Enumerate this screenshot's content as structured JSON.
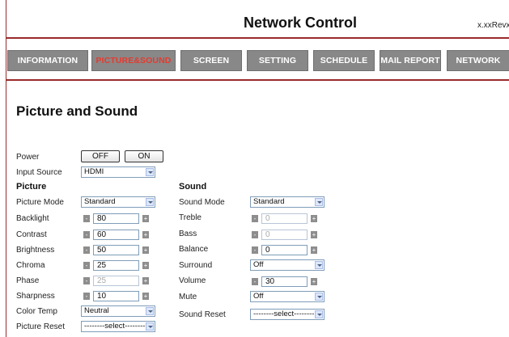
{
  "header": {
    "title": "Network Control",
    "revision": "x.xxRevx"
  },
  "nav": [
    {
      "label": "INFORMATION",
      "active": false
    },
    {
      "label": "PICTURE&SOUND",
      "active": true
    },
    {
      "label": "SCREEN",
      "active": false
    },
    {
      "label": "SETTING",
      "active": false
    },
    {
      "label": "SCHEDULE",
      "active": false
    },
    {
      "label": "MAIL REPORT",
      "active": false
    },
    {
      "label": "NETWORK",
      "active": false
    }
  ],
  "page_title": "Picture and Sound",
  "power": {
    "label": "Power",
    "off": "OFF",
    "on": "ON"
  },
  "input_source": {
    "label": "Input Source",
    "value": "HDMI"
  },
  "picture": {
    "heading": "Picture",
    "picture_mode": {
      "label": "Picture Mode",
      "value": "Standard"
    },
    "backlight": {
      "label": "Backlight",
      "value": "80"
    },
    "contrast": {
      "label": "Contrast",
      "value": "60"
    },
    "brightness": {
      "label": "Brightness",
      "value": "50"
    },
    "chroma": {
      "label": "Chroma",
      "value": "25"
    },
    "phase": {
      "label": "Phase",
      "value": "25"
    },
    "sharpness": {
      "label": "Sharpness",
      "value": "10"
    },
    "color_temp": {
      "label": "Color Temp",
      "value": "Neutral"
    },
    "picture_reset": {
      "label": "Picture Reset",
      "value": "--------select--------"
    }
  },
  "sound": {
    "heading": "Sound",
    "sound_mode": {
      "label": "Sound Mode",
      "value": "Standard"
    },
    "treble": {
      "label": "Treble",
      "value": "0"
    },
    "bass": {
      "label": "Bass",
      "value": "0"
    },
    "balance": {
      "label": "Balance",
      "value": "0"
    },
    "surround": {
      "label": "Surround",
      "value": "Off"
    },
    "volume": {
      "label": "Volume",
      "value": "30"
    },
    "mute": {
      "label": "Mute",
      "value": "Off"
    },
    "sound_reset": {
      "label": "Sound Reset",
      "value": "--------select--------"
    }
  },
  "icons": {
    "minus": "-",
    "plus": "+"
  },
  "colors": {
    "accent": "#9a2a2a",
    "nav_bg": "#888888",
    "active_nav_text": "#e63a2e"
  }
}
